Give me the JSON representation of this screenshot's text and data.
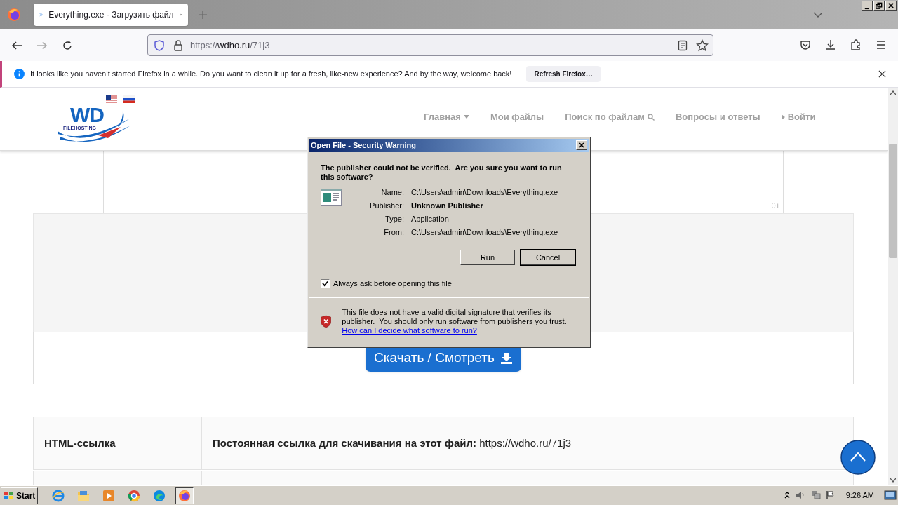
{
  "browser": {
    "tabs": [
      {
        "title": "Everything.exe - Загрузить файл",
        "selected": true
      }
    ],
    "address": {
      "scheme": "https://",
      "host": "wdho.ru",
      "path": "/71j3"
    },
    "notification": {
      "message": "It looks like you haven’t started Firefox in a while. Do you want to clean it up for a fresh, like-new experience? And by the way, welcome back!",
      "button": "Refresh Firefox…"
    }
  },
  "site": {
    "logo": {
      "text": "WD",
      "subtitle": "FILEHOSTING"
    },
    "nav": [
      {
        "label": "Главная",
        "kind": "dropdown"
      },
      {
        "label": "Мои файлы",
        "kind": "plain"
      },
      {
        "label": "Поиск по файлам",
        "kind": "search"
      },
      {
        "label": "Вопросы и ответы",
        "kind": "plain"
      },
      {
        "label": "Войти",
        "kind": "login"
      }
    ],
    "counter": "0+",
    "download_button": "Скачать / Смотреть",
    "links": [
      {
        "label": "HTML-ссылка",
        "text": "**Постоянная ссылка для скачивания на этот файл:** https://wdho.ru/71j3"
      }
    ]
  },
  "dialog": {
    "title": "Open File - Security Warning",
    "question": "The publisher could not be verified.  Are you sure you want to run this software?",
    "fields": [
      {
        "label": "Name:",
        "value": "C:\\Users\\admin\\Downloads\\Everything.exe",
        "kind": "plain"
      },
      {
        "label": "Publisher:",
        "value": "Unknown Publisher",
        "kind": "bold"
      },
      {
        "label": "Type:",
        "value": "Application",
        "kind": "plain"
      },
      {
        "label": "From:",
        "value": "C:\\Users\\admin\\Downloads\\Everything.exe",
        "kind": "plain"
      }
    ],
    "buttons": [
      {
        "label": "Run",
        "default": false
      },
      {
        "label": "Cancel",
        "default": true
      }
    ],
    "always_ask": {
      "label": "Always ask before opening this file",
      "checked": true
    },
    "warning": "This file does not have a valid digital signature that verifies its publisher.  You should only run software from publishers you trust.",
    "help_link": "How can I decide what software to run?"
  },
  "taskbar": {
    "start": "Start",
    "clock": "9:26 AM",
    "apps": [
      {
        "kind": "ie",
        "selected": false
      },
      {
        "kind": "folder",
        "selected": false
      },
      {
        "kind": "media",
        "selected": false
      },
      {
        "kind": "chrome",
        "selected": false
      },
      {
        "kind": "edge",
        "selected": false
      },
      {
        "kind": "firefox",
        "selected": true
      }
    ]
  }
}
